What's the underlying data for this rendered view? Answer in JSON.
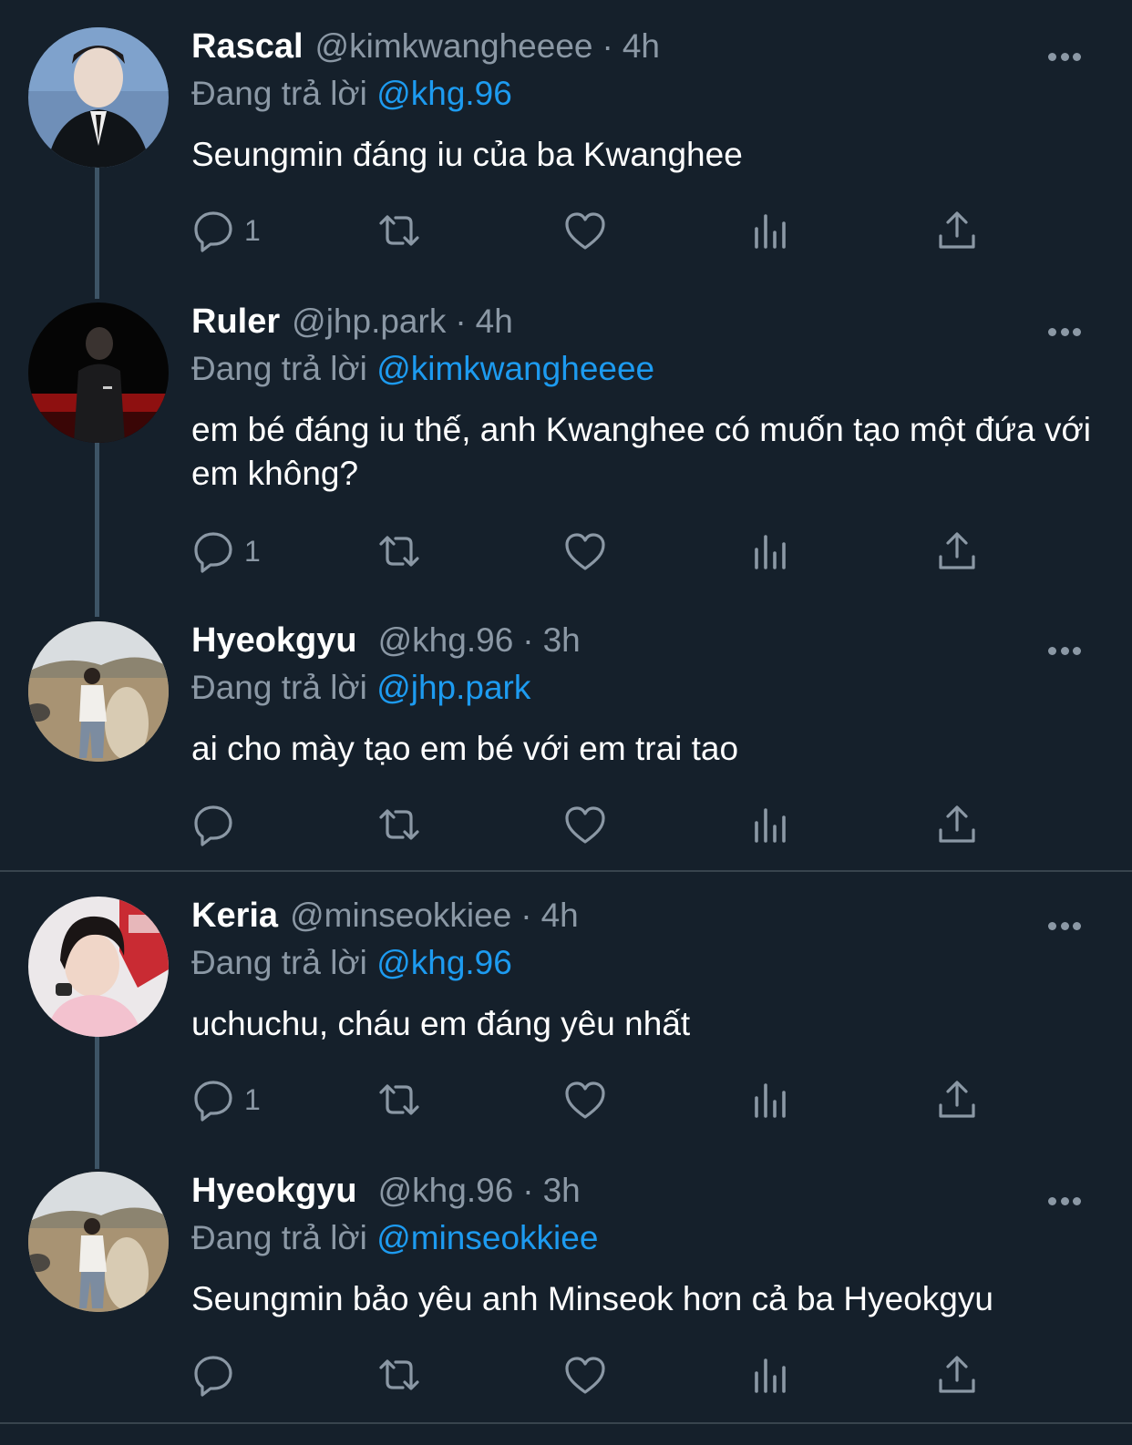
{
  "tweets": [
    {
      "name": "Rascal",
      "handle": "@kimkwangheeee",
      "dot": "·",
      "time": "4h",
      "replying_prefix": "Đang trả lời",
      "replying_to": "@khg.96",
      "text": "Seungmin đáng iu của ba Kwanghee",
      "reply_count": "1",
      "avatar_icon": "avatar-icon"
    },
    {
      "name": "Ruler",
      "handle": "@jhp.park",
      "dot": "·",
      "time": "4h",
      "replying_prefix": "Đang trả lời",
      "replying_to": "@kimkwangheeee",
      "text": "em bé đáng iu thế, anh Kwanghee có muốn tạo một đứa với em không?",
      "reply_count": "1",
      "avatar_icon": "avatar-icon"
    },
    {
      "name": "Hyeokgyu",
      "handle": "@khg.96",
      "dot": "·",
      "time": "3h",
      "replying_prefix": "Đang trả lời",
      "replying_to": "@jhp.park",
      "text": "ai cho mày tạo em bé với em trai tao",
      "reply_count": "",
      "avatar_icon": "avatar-icon"
    },
    {
      "name": "Keria",
      "handle": "@minseokkiee",
      "dot": "·",
      "time": "4h",
      "replying_prefix": "Đang trả lời",
      "replying_to": "@khg.96",
      "text": "uchuchu, cháu em đáng yêu nhất",
      "reply_count": "1",
      "avatar_icon": "avatar-icon"
    },
    {
      "name": "Hyeokgyu",
      "handle": "@khg.96",
      "dot": "·",
      "time": "3h",
      "replying_prefix": "Đang trả lời",
      "replying_to": "@minseokkiee",
      "text": "Seungmin bảo yêu anh Minseok hơn cả ba Hyeokgyu",
      "reply_count": "",
      "avatar_icon": "avatar-icon"
    }
  ],
  "colors": {
    "background": "#15202b",
    "muted": "#8b98a5",
    "mention": "#1d9bf0",
    "thread_line": "#3d5466"
  }
}
